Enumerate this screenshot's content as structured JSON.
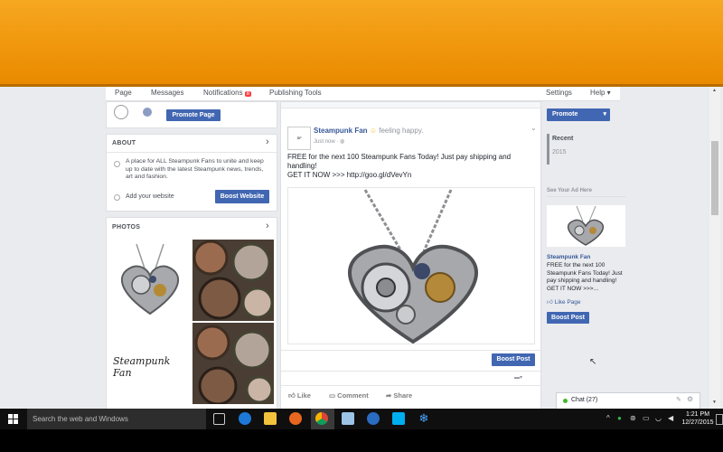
{
  "nav": {
    "page": "Page",
    "messages": "Messages",
    "notifications": "Notifications",
    "notif_count": "8",
    "publishing": "Publishing Tools",
    "settings": "Settings",
    "help": "Help ▾"
  },
  "left": {
    "promote_page": "Promote Page",
    "about_title": "ABOUT",
    "about_text": "A place for ALL Steampunk Fans to unite and keep up to date with the latest Steampunk news, trends, art and fashion.",
    "add_website": "Add your website",
    "boost_website": "Boost Website",
    "photos_title": "PHOTOS",
    "logo_text": "Steampunk Fan"
  },
  "post": {
    "page_name": "Steampunk Fan",
    "feeling": "feeling happy.",
    "time": "Just now · ",
    "line1": "FREE for the next 100 Steampunk Fans Today! Just pay shipping and handling!",
    "line2": "GET IT NOW >>> http://goo.gl/dVevYn",
    "boost_post": "Boost Post",
    "like": "Like",
    "comment": "Comment",
    "share": "Share"
  },
  "right": {
    "promote": "Promote",
    "recent": "Recent",
    "year": "2015",
    "see_ad": "See Your Ad Here",
    "ad_name": "Steampunk Fan",
    "ad_text": "FREE for the next 100 Steampunk Fans Today! Just pay shipping and handling! GET IT NOW >>>...",
    "like_page": "Like Page",
    "boost_post": "Boost Post",
    "chat": "Chat (27)"
  },
  "taskbar": {
    "search": "Search the web and Windows",
    "time": "1:21 PM",
    "date": "12/27/2015"
  },
  "colors": {
    "accent": "#4267b2",
    "link": "#365899",
    "orange": "#f19a10"
  }
}
